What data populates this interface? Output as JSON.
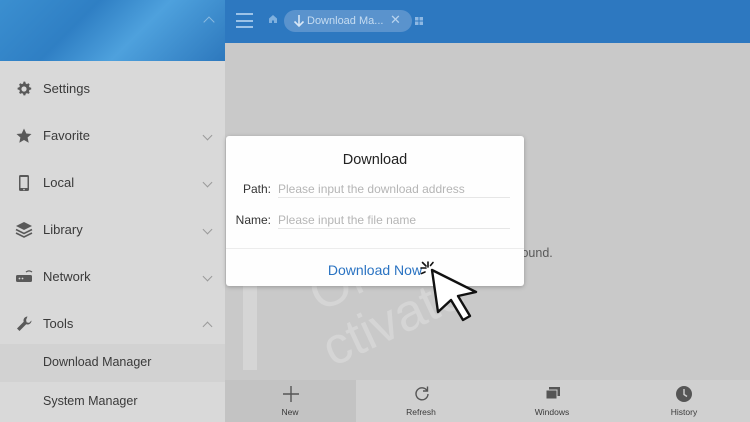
{
  "sidebar": {
    "items": [
      {
        "label": "Settings",
        "icon": "gear-icon"
      },
      {
        "label": "Favorite",
        "icon": "star-icon"
      },
      {
        "label": "Local",
        "icon": "phone-icon"
      },
      {
        "label": "Library",
        "icon": "layers-icon"
      },
      {
        "label": "Network",
        "icon": "router-icon"
      },
      {
        "label": "Tools",
        "icon": "wrench-icon"
      }
    ],
    "tools_sub": [
      "Download Manager",
      "System Manager"
    ]
  },
  "topbar": {
    "tab_label": "Download Ma..."
  },
  "content": {
    "empty_text": "found."
  },
  "dialog": {
    "title": "Download",
    "path_label": "Path:",
    "path_placeholder": "Please input the download address",
    "name_label": "Name:",
    "name_placeholder": "Please input the file name",
    "button_label": "Download Now"
  },
  "bottombar": {
    "new": "New",
    "refresh": "Refresh",
    "windows": "Windows",
    "history": "History"
  },
  "watermark": {
    "line1": "One Click",
    "line2": "ctivate"
  },
  "colors": {
    "topbar": "#2d78c0",
    "accent": "#2a73c2",
    "sidebar": "#d9d9d9",
    "content": "#c9c9c9"
  }
}
